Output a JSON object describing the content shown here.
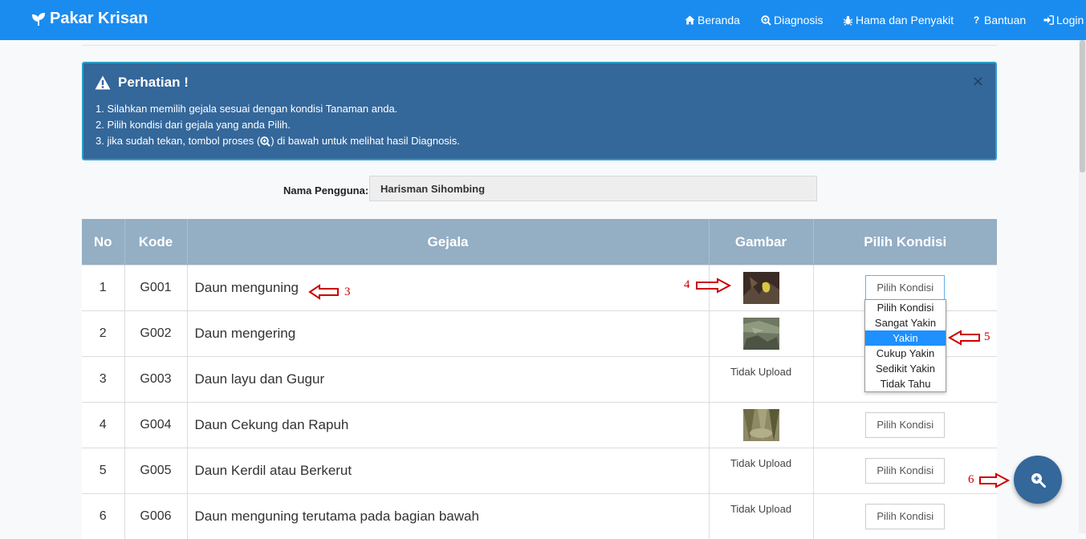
{
  "navbar": {
    "brand": "Pakar Krisan",
    "items": [
      {
        "label": "Beranda",
        "icon": "home-icon"
      },
      {
        "label": "Diagnosis",
        "icon": "search-plus-icon"
      },
      {
        "label": "Hama dan Penyakit",
        "icon": "bug-icon"
      },
      {
        "label": "Bantuan",
        "icon": "question-icon"
      },
      {
        "label": "Login",
        "icon": "login-icon"
      }
    ]
  },
  "alert": {
    "title": "Perhatian !",
    "line1": "1. Silahkan memilih gejala sesuai dengan kondisi Tanaman anda.",
    "line2": "2. Pilih kondisi dari gejala yang anda Pilih.",
    "line3_pre": "3. jika sudah tekan, tombol proses (",
    "line3_post": ") di bawah untuk melihat hasil Diagnosis.",
    "close": "×"
  },
  "user": {
    "label": "Nama Pengguna:",
    "value": "Harisman Sihombing"
  },
  "table": {
    "headers": [
      "No",
      "Kode",
      "Gejala",
      "Gambar",
      "Pilih Kondisi"
    ],
    "rows": [
      {
        "no": "1",
        "kode": "G001",
        "gejala": "Daun menguning",
        "gambar": "",
        "kondisi": "Pilih Kondisi"
      },
      {
        "no": "2",
        "kode": "G002",
        "gejala": "Daun mengering",
        "gambar": "",
        "kondisi": ""
      },
      {
        "no": "3",
        "kode": "G003",
        "gejala": "Daun layu dan Gugur",
        "gambar": "Tidak Upload",
        "kondisi": ""
      },
      {
        "no": "4",
        "kode": "G004",
        "gejala": "Daun Cekung dan Rapuh",
        "gambar": "",
        "kondisi": "Pilih Kondisi"
      },
      {
        "no": "5",
        "kode": "G005",
        "gejala": "Daun Kerdil atau Berkerut",
        "gambar": "Tidak Upload",
        "kondisi": "Pilih Kondisi"
      },
      {
        "no": "6",
        "kode": "G006",
        "gejala": "Daun menguning terutama pada bagian bawah",
        "gambar": "Tidak Upload",
        "kondisi": "Pilih Kondisi"
      }
    ]
  },
  "dropdown": {
    "options": [
      "Pilih Kondisi",
      "Sangat Yakin",
      "Yakin",
      "Cukup Yakin",
      "Sedikit Yakin",
      "Tidak Tahu"
    ],
    "selected": "Yakin"
  },
  "annotations": {
    "a3": "3",
    "a4": "4",
    "a5": "5",
    "a6": "6",
    "arrow_color": "#cc0000"
  },
  "colors": {
    "navbar": "#1a8cf0",
    "alert": "#34679a",
    "table_header": "#94aec4",
    "fab": "#34679a"
  }
}
